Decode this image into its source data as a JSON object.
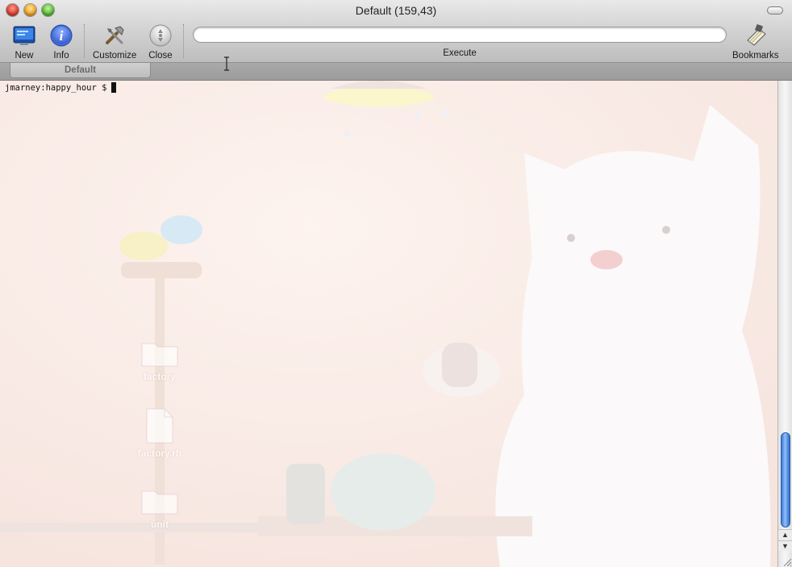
{
  "window": {
    "title": "Default (159,43)"
  },
  "toolbar": {
    "new_label": "New",
    "info_label": "Info",
    "customize_label": "Customize",
    "close_label": "Close",
    "command_value": "",
    "execute_label": "Execute",
    "bookmarks_label": "Bookmarks"
  },
  "tabs": [
    {
      "label": "Default"
    }
  ],
  "terminal": {
    "prompt": "jmarney:happy_hour $"
  },
  "desktop": {
    "icons": [
      {
        "name": "factory",
        "kind": "folder-icon"
      },
      {
        "name": "factory.rb",
        "kind": "document-icon"
      },
      {
        "name": "unit",
        "kind": "folder-icon"
      }
    ]
  },
  "colors": {
    "terminal_bg": "#fbefeb",
    "scroll_accent": "#3a78d6"
  }
}
